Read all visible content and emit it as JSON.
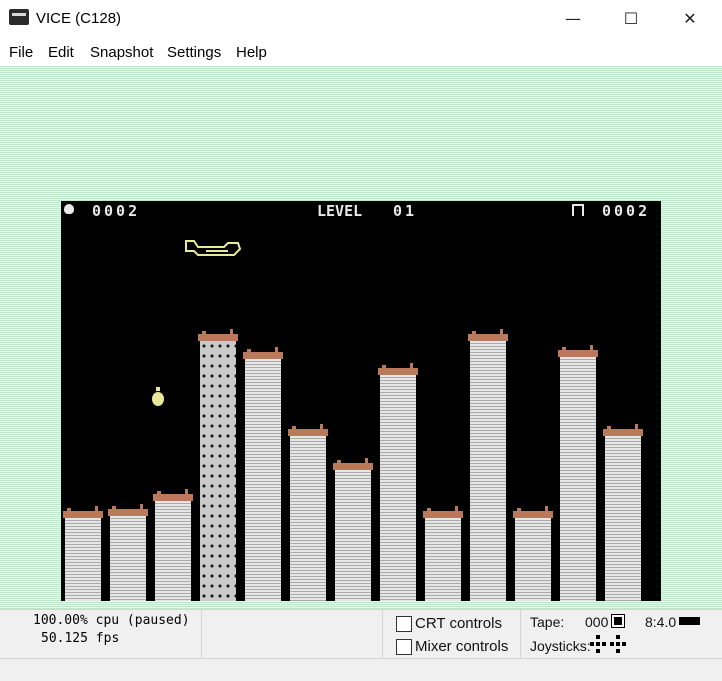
{
  "window": {
    "title": "VICE (C128)",
    "minimize": "—",
    "maximize": "☐",
    "close": "✕"
  },
  "menu": [
    "File",
    "Edit",
    "Snapshot",
    "Settings",
    "Help"
  ],
  "game": {
    "score_left": "0002",
    "level_label": "LEVEL",
    "level_value": "01",
    "score_right": "0002"
  },
  "status": {
    "cpu": "100.00% cpu (paused)",
    "fps": "50.125 fps",
    "crt_label": "CRT controls",
    "mixer_label": "Mixer controls",
    "tape_label": "Tape:",
    "tape_counter": "000",
    "drive_label": "8:4.0",
    "joysticks_label": "Joysticks:"
  },
  "colors": {
    "border": "#c8ecd0",
    "roof": "#b87a5a",
    "plane": "#e8e89a"
  }
}
